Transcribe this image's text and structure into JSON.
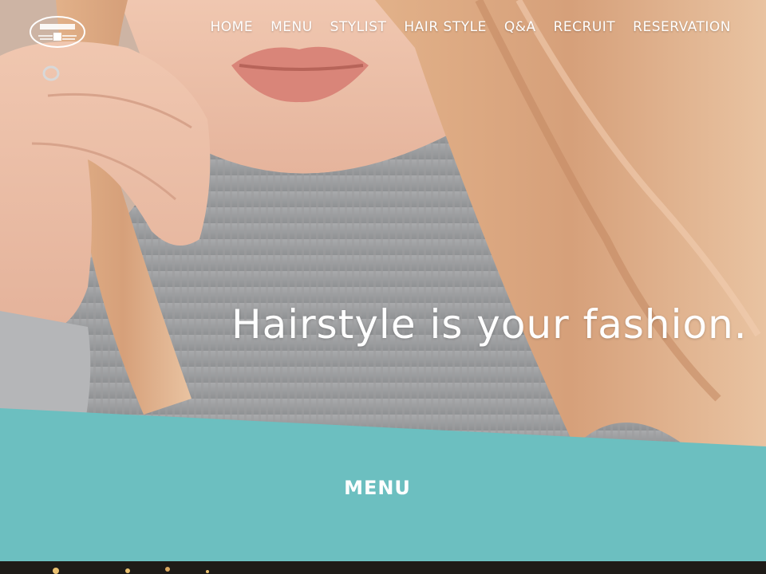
{
  "logo": {
    "icon": "salon-logo-icon"
  },
  "nav": {
    "items": [
      {
        "label": "HOME"
      },
      {
        "label": "MENU"
      },
      {
        "label": "STYLIST"
      },
      {
        "label": "HAIR STYLE"
      },
      {
        "label": "Q&A"
      },
      {
        "label": "RECRUIT"
      },
      {
        "label": "RESERVATION"
      }
    ]
  },
  "hero": {
    "tagline": "Hairstyle is your fashion."
  },
  "section": {
    "heading": "MENU"
  },
  "colors": {
    "accent": "#6cbfc0",
    "text_on_dark": "#ffffff"
  }
}
